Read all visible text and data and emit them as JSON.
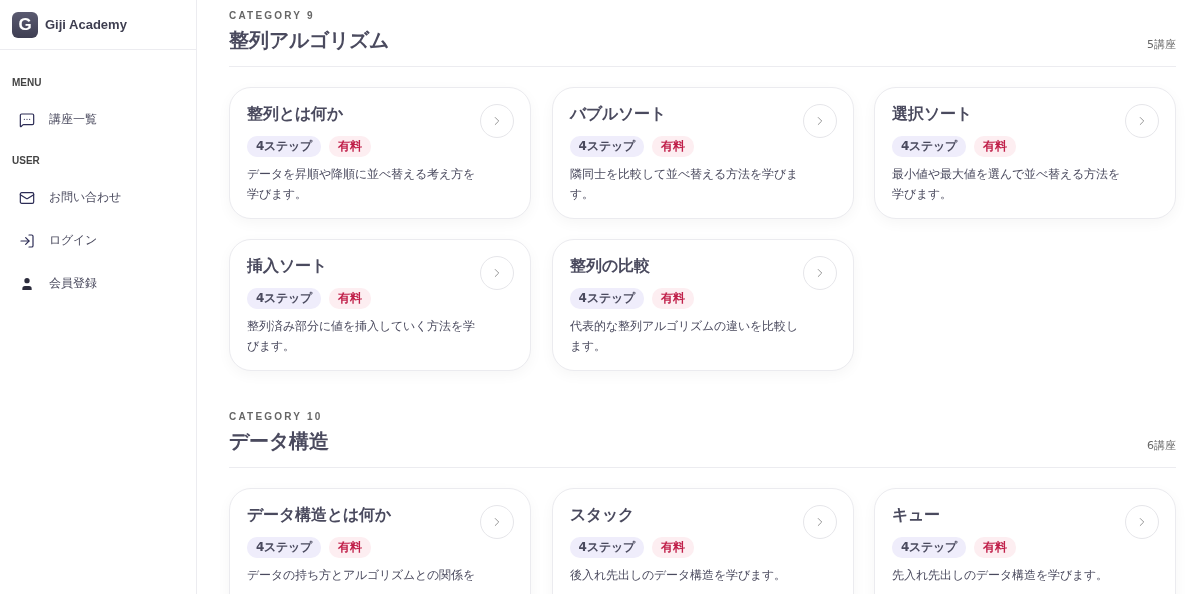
{
  "brand": {
    "logo_letter": "G",
    "name": "Giji Academy"
  },
  "sidebar": {
    "sections": [
      {
        "heading": "MENU",
        "items": [
          {
            "label": "講座一覧",
            "kind": "chat"
          }
        ]
      },
      {
        "heading": "USER",
        "items": [
          {
            "label": "お問い合わせ",
            "kind": "mail"
          },
          {
            "label": "ログイン",
            "kind": "login"
          },
          {
            "label": "会員登録",
            "kind": "person"
          }
        ]
      }
    ]
  },
  "categories": [
    {
      "label": "CATEGORY 9",
      "title": "整列アルゴリズム",
      "count": "5講座",
      "courses": [
        {
          "title": "整列とは何か",
          "tags": [
            {
              "text": "4ステップ",
              "kind": "steps"
            },
            {
              "text": "有料",
              "kind": "paid"
            }
          ],
          "description": "データを昇順や降順に並べ替える考え方を学びます。"
        },
        {
          "title": "バブルソート",
          "tags": [
            {
              "text": "4ステップ",
              "kind": "steps"
            },
            {
              "text": "有料",
              "kind": "paid"
            }
          ],
          "description": "隣同士を比較して並べ替える方法を学びます。"
        },
        {
          "title": "選択ソート",
          "tags": [
            {
              "text": "4ステップ",
              "kind": "steps"
            },
            {
              "text": "有料",
              "kind": "paid"
            }
          ],
          "description": "最小値や最大値を選んで並べ替える方法を学びます。"
        },
        {
          "title": "挿入ソート",
          "tags": [
            {
              "text": "4ステップ",
              "kind": "steps"
            },
            {
              "text": "有料",
              "kind": "paid"
            }
          ],
          "description": "整列済み部分に値を挿入していく方法を学びます。"
        },
        {
          "title": "整列の比較",
          "tags": [
            {
              "text": "4ステップ",
              "kind": "steps"
            },
            {
              "text": "有料",
              "kind": "paid"
            }
          ],
          "description": "代表的な整列アルゴリズムの違いを比較します。"
        }
      ]
    },
    {
      "label": "CATEGORY 10",
      "title": "データ構造",
      "count": "6講座",
      "courses": [
        {
          "title": "データ構造とは何か",
          "tags": [
            {
              "text": "4ステップ",
              "kind": "steps"
            },
            {
              "text": "有料",
              "kind": "paid"
            }
          ],
          "description": "データの持ち方とアルゴリズムとの関係を"
        },
        {
          "title": "スタック",
          "tags": [
            {
              "text": "4ステップ",
              "kind": "steps"
            },
            {
              "text": "有料",
              "kind": "paid"
            }
          ],
          "description": "後入れ先出しのデータ構造を学びます。"
        },
        {
          "title": "キュー",
          "tags": [
            {
              "text": "4ステップ",
              "kind": "steps"
            },
            {
              "text": "有料",
              "kind": "paid"
            }
          ],
          "description": "先入れ先出しのデータ構造を学びます。"
        }
      ]
    }
  ]
}
